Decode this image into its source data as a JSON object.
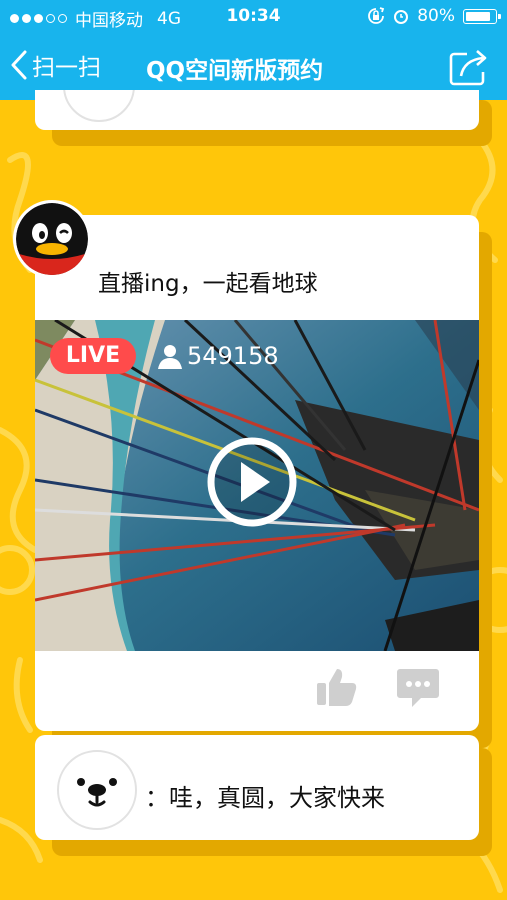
{
  "status_bar": {
    "carrier": "中国移动",
    "network": "4G",
    "time": "10:34",
    "battery": "80%",
    "battery_level": 0.8
  },
  "nav": {
    "back_label": "扫一扫",
    "title": "QQ空间新版预约"
  },
  "post": {
    "text": "直播ing，一起看地球",
    "live_label": "LIVE",
    "viewer_count": "549158"
  },
  "comment": {
    "text": "：哇，真圆，大家快来"
  },
  "colors": {
    "nav_bg": "#18b4ed",
    "page_bg": "#ffc60a",
    "live_badge": "#ff4b4b",
    "action_icon": "#cfcfcf"
  }
}
